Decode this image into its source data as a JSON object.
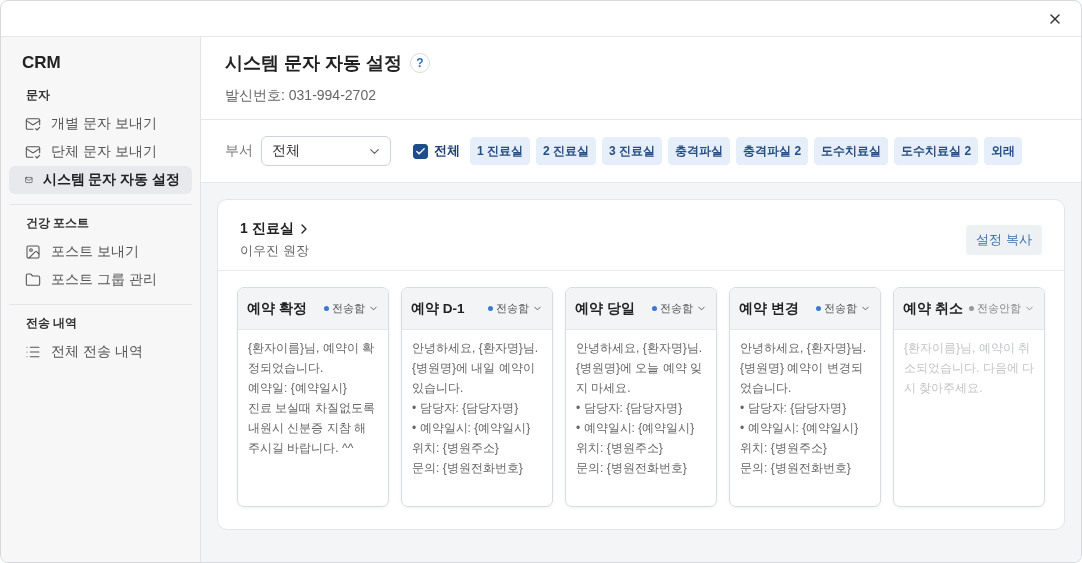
{
  "sidebar": {
    "title": "CRM",
    "sections": [
      {
        "heading": "문자",
        "items": [
          {
            "label": "개별 문자 보내기",
            "kind": "compose",
            "selected": false
          },
          {
            "label": "단체 문자 보내기",
            "kind": "compose",
            "selected": false
          },
          {
            "label": "시스템 문자 자동 설정",
            "kind": "auto",
            "selected": true
          }
        ]
      },
      {
        "heading": "건강 포스트",
        "items": [
          {
            "label": "포스트 보내기",
            "kind": "post",
            "selected": false
          },
          {
            "label": "포스트 그룹 관리",
            "kind": "group",
            "selected": false
          }
        ]
      },
      {
        "heading": "전송 내역",
        "items": [
          {
            "label": "전체 전송 내역",
            "kind": "history",
            "selected": false
          }
        ]
      }
    ]
  },
  "header": {
    "title": "시스템 문자 자동 설정",
    "help": "?",
    "sender": "발신번호: 031-994-2702"
  },
  "filter": {
    "label": "부서",
    "select_value": "전체",
    "all_checkbox": {
      "label": "전체",
      "checked": true
    },
    "chips": [
      {
        "label": "1 진료실",
        "selected": true
      },
      {
        "label": "2 진료실",
        "selected": true
      },
      {
        "label": "3 진료실",
        "selected": true
      },
      {
        "label": "충격파실",
        "selected": true
      },
      {
        "label": "충격파실 2",
        "selected": true
      },
      {
        "label": "도수치료실",
        "selected": true
      },
      {
        "label": "도수치료실 2",
        "selected": true
      },
      {
        "label": "외래",
        "selected": true
      }
    ]
  },
  "department": {
    "name": "1 진료실",
    "doctor": "이우진 원장",
    "copy_button": "설정 복사",
    "templates": [
      {
        "title": "예약 확정",
        "status": "전송함",
        "on": true,
        "message": "{환자이름}님, 예약이 확정되었습니다.\n예약일: {예약일시}\n진료 보실때 차질없도록 내원시 신분증 지참 해 주시길 바랍니다. ^^"
      },
      {
        "title": "예약 D-1",
        "status": "전송함",
        "on": true,
        "message": "안녕하세요, {환자명}님. {병원명}에 내일 예약이 있습니다.\n• 담당자: {담당자명}\n• 예약일시: {예약일시}\n위치: {병원주소}\n문의: {병원전화번호}"
      },
      {
        "title": "예약 당일",
        "status": "전송함",
        "on": true,
        "message": "안녕하세요, {환자명}님. {병원명}에 오늘 예약 잊지 마세요.\n• 담당자: {담당자명}\n• 예약일시: {예약일시}\n위치: {병원주소}\n문의: {병원전화번호}"
      },
      {
        "title": "예약 변경",
        "status": "전송함",
        "on": true,
        "message": "안녕하세요, {환자명}님. {병원명} 예약이 변경되었습니다.\n• 담당자: {담당자명}\n• 예약일시: {예약일시}\n위치: {병원주소}\n문의: {병원전화번호}"
      },
      {
        "title": "예약 취소",
        "status": "전송안함",
        "on": false,
        "message": "{환자이름}님, 예약이 취소되었습니다. 다음에 다시 찾아주세요."
      }
    ]
  }
}
